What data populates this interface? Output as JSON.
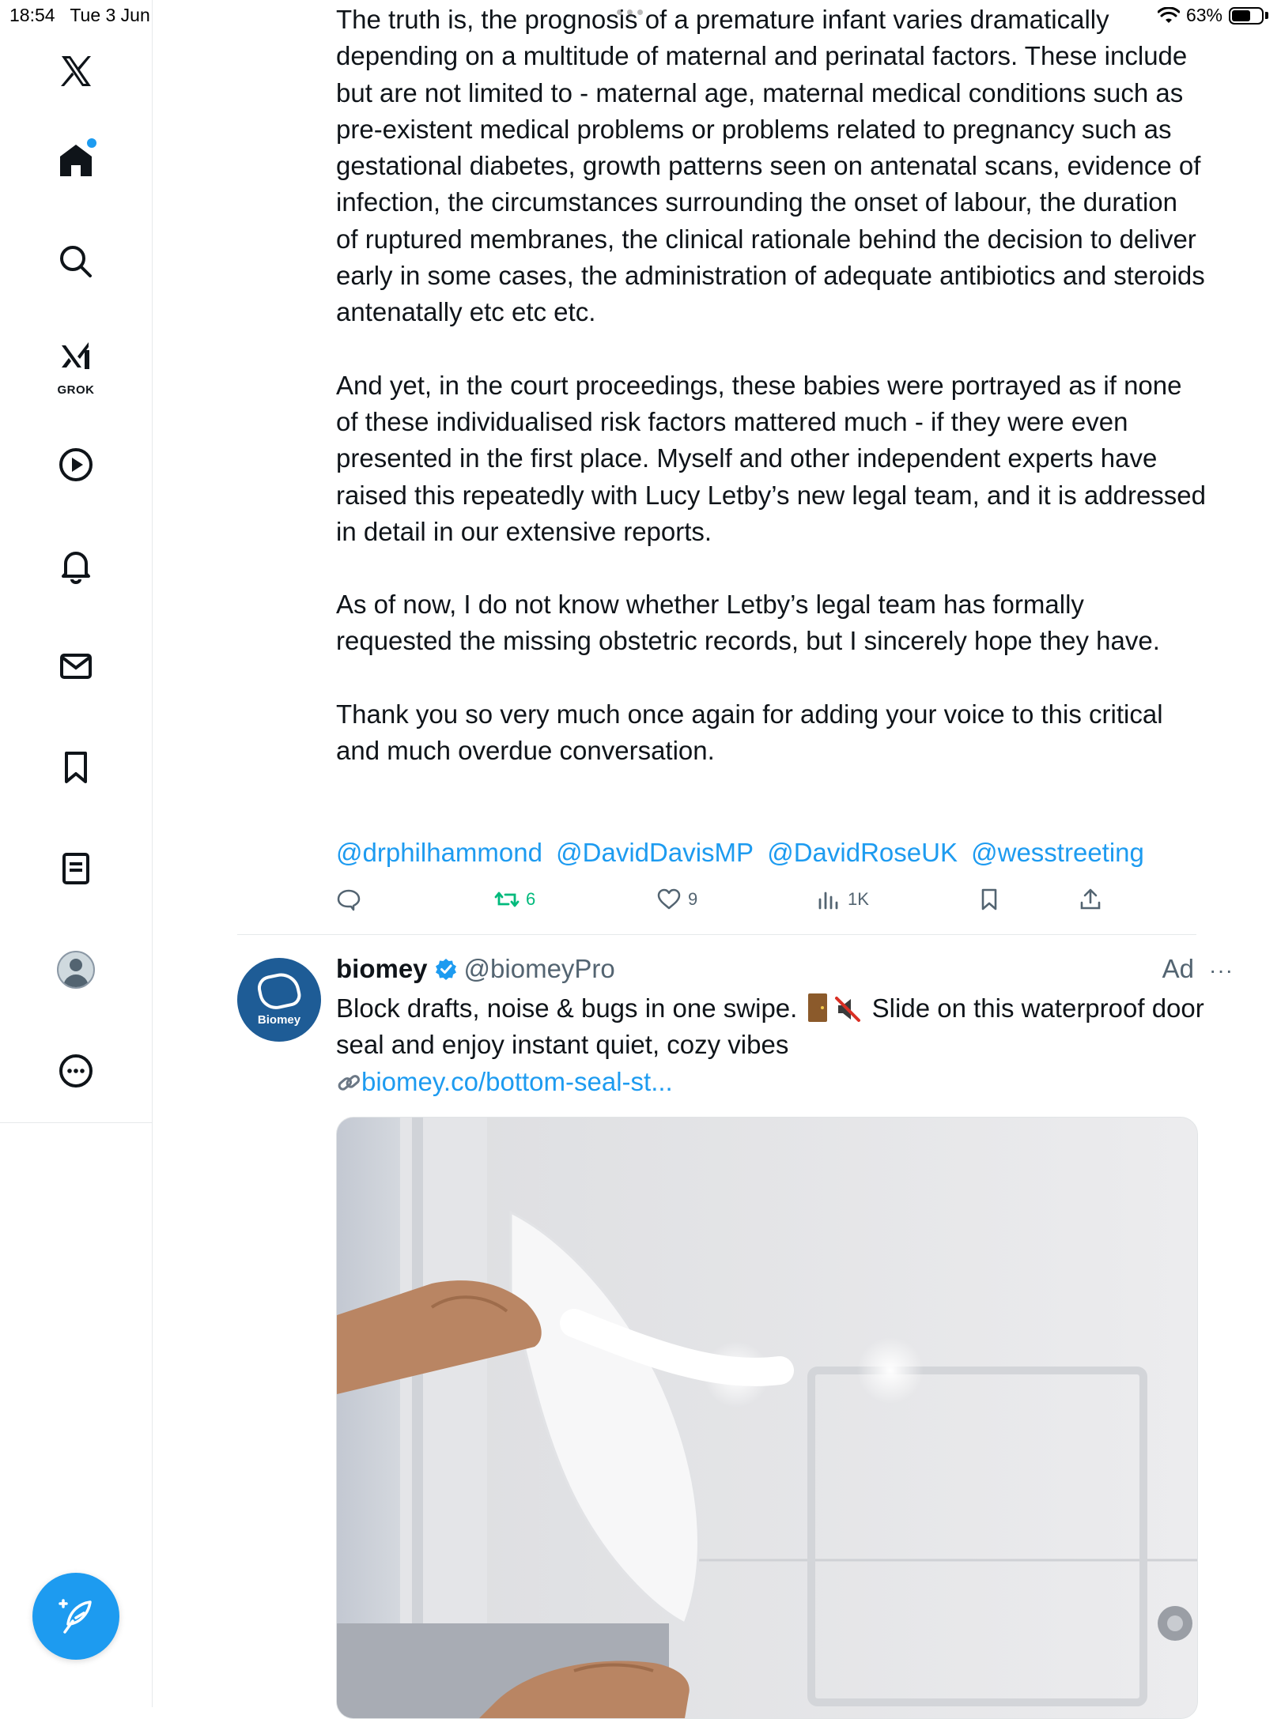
{
  "status_bar": {
    "time": "18:54",
    "date": "Tue 3 Jun",
    "battery_text": "63%",
    "battery_level": 0.63
  },
  "nav": {
    "grok_label": "GROK",
    "items": [
      "home",
      "explore",
      "grok",
      "video",
      "notifications",
      "messages",
      "bookmarks",
      "lists",
      "profile",
      "more"
    ]
  },
  "tweet": {
    "paragraphs": [
      "The truth is, the prognosis of a premature infant varies dramatically depending on a multitude of maternal and perinatal factors. These include but are not limited to - maternal age, maternal medical conditions such as pre-existent medical problems or problems related to pregnancy such as gestational diabetes, growth patterns seen on antenatal scans, evidence of infection, the circumstances surrounding the onset of labour, the duration of ruptured membranes, the clinical rationale behind the decision to deliver early in some cases, the administration of adequate antibiotics and steroids antenatally etc etc etc.",
      "And yet, in the court proceedings, these babies were portrayed as if none of these individualised risk factors mattered much - if they were even presented in the first place. Myself and other independent experts have raised this repeatedly with Lucy Letby’s new legal team, and it is addressed in detail in our extensive reports.",
      "As of now, I do not know whether Letby’s legal team has formally requested the missing obstetric records, but I sincerely hope they have.",
      "Thank you so very much once again for adding your voice to this critical and much overdue conversation."
    ],
    "mentions": [
      "@drphilhammond",
      "@DavidDavisMP",
      "@DavidRoseUK",
      "@wesstreeting"
    ],
    "stats": {
      "replies": "",
      "reposts": "6",
      "likes": "9",
      "views": "1K"
    }
  },
  "ad": {
    "avatar_text": "Biomey",
    "name": "biomey",
    "handle": "@biomeyPro",
    "label": "Ad",
    "more": "···",
    "text_part1": "Block drafts, noise & bugs in one swipe.",
    "text_part2": "Slide on this waterproof door seal and enjoy instant quiet, cozy vibes",
    "link": "biomey.co/bottom-seal-st..."
  },
  "colors": {
    "accent": "#1d9bf0",
    "repost_active": "#00ba7c",
    "text": "#0f1419",
    "muted": "#536471",
    "ad_brand": "#1e5c96"
  }
}
